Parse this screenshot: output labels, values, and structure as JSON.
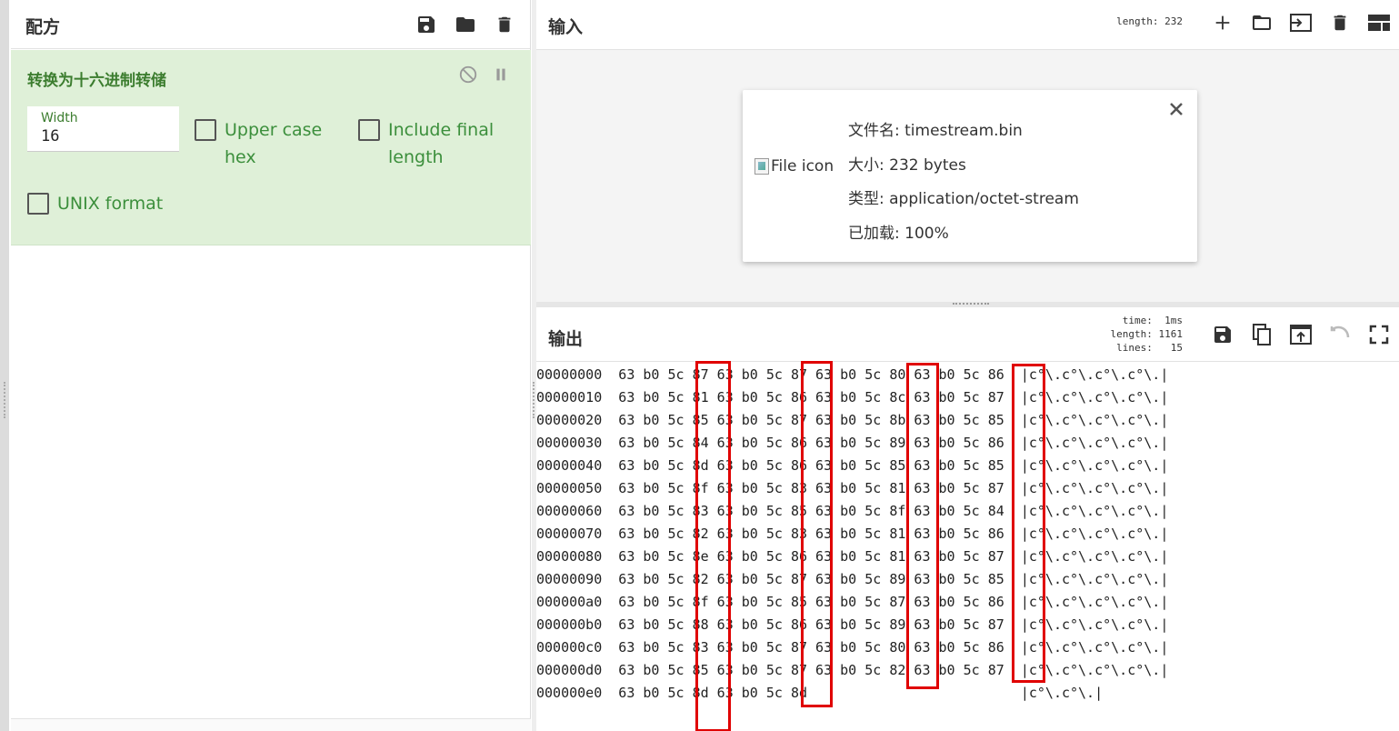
{
  "recipe": {
    "title": "配方",
    "icons": [
      "save-icon",
      "folder-icon",
      "trash-icon"
    ],
    "operation": {
      "title": "转换为十六进制转储",
      "width_label": "Width",
      "width_value": "16",
      "checkboxes": [
        {
          "label": "Upper case hex",
          "checked": false
        },
        {
          "label": "Include final length",
          "checked": false
        },
        {
          "label": "UNIX format",
          "checked": false
        }
      ]
    }
  },
  "input": {
    "title": "输入",
    "length_label": "length:",
    "length_value": "232",
    "icons": [
      "plus-icon",
      "folder-icon",
      "import-icon",
      "trash-icon",
      "layout-icon"
    ],
    "file": {
      "icon_alt": "File icon",
      "name_label": "文件名:",
      "name_value": "timestream.bin",
      "size_label": "大小:",
      "size_value": "232 bytes",
      "type_label": "类型:",
      "type_value": "application/octet-stream",
      "loaded_label": "已加载:",
      "loaded_value": "100%"
    }
  },
  "output": {
    "title": "输出",
    "time_label": "time:",
    "time_value": "1ms",
    "length_label": "length:",
    "length_value": "1161",
    "lines_label": "lines:",
    "lines_value": "15",
    "icons": [
      "save-icon",
      "copy-icon",
      "replace-input-icon",
      "undo-icon",
      "maximize-icon"
    ],
    "lines": [
      "00000000  63 b0 5c 87 63 b0 5c 87 63 b0 5c 80 63 b0 5c 86  |c°\\.c°\\.c°\\.c°\\.|",
      "00000010  63 b0 5c 81 63 b0 5c 86 63 b0 5c 8c 63 b0 5c 87  |c°\\.c°\\.c°\\.c°\\.|",
      "00000020  63 b0 5c 85 63 b0 5c 87 63 b0 5c 8b 63 b0 5c 85  |c°\\.c°\\.c°\\.c°\\.|",
      "00000030  63 b0 5c 84 63 b0 5c 86 63 b0 5c 89 63 b0 5c 86  |c°\\.c°\\.c°\\.c°\\.|",
      "00000040  63 b0 5c 8d 63 b0 5c 86 63 b0 5c 85 63 b0 5c 85  |c°\\.c°\\.c°\\.c°\\.|",
      "00000050  63 b0 5c 8f 63 b0 5c 83 63 b0 5c 81 63 b0 5c 87  |c°\\.c°\\.c°\\.c°\\.|",
      "00000060  63 b0 5c 83 63 b0 5c 85 63 b0 5c 8f 63 b0 5c 84  |c°\\.c°\\.c°\\.c°\\.|",
      "00000070  63 b0 5c 82 63 b0 5c 83 63 b0 5c 81 63 b0 5c 86  |c°\\.c°\\.c°\\.c°\\.|",
      "00000080  63 b0 5c 8e 63 b0 5c 86 63 b0 5c 81 63 b0 5c 87  |c°\\.c°\\.c°\\.c°\\.|",
      "00000090  63 b0 5c 82 63 b0 5c 87 63 b0 5c 89 63 b0 5c 85  |c°\\.c°\\.c°\\.c°\\.|",
      "000000a0  63 b0 5c 8f 63 b0 5c 85 63 b0 5c 87 63 b0 5c 86  |c°\\.c°\\.c°\\.c°\\.|",
      "000000b0  63 b0 5c 88 63 b0 5c 86 63 b0 5c 89 63 b0 5c 87  |c°\\.c°\\.c°\\.c°\\.|",
      "000000c0  63 b0 5c 83 63 b0 5c 87 63 b0 5c 80 63 b0 5c 86  |c°\\.c°\\.c°\\.c°\\.|",
      "000000d0  63 b0 5c 85 63 b0 5c 87 63 b0 5c 82 63 b0 5c 87  |c°\\.c°\\.c°\\.c°\\.|",
      "000000e0  63 b0 5c 8d 63 b0 5c 8d                          |c°\\.c°\\.|"
    ]
  },
  "colors": {
    "operation_bg": "#dff0d8",
    "operation_text": "#3c7d2f",
    "highlight": "#e00000"
  }
}
